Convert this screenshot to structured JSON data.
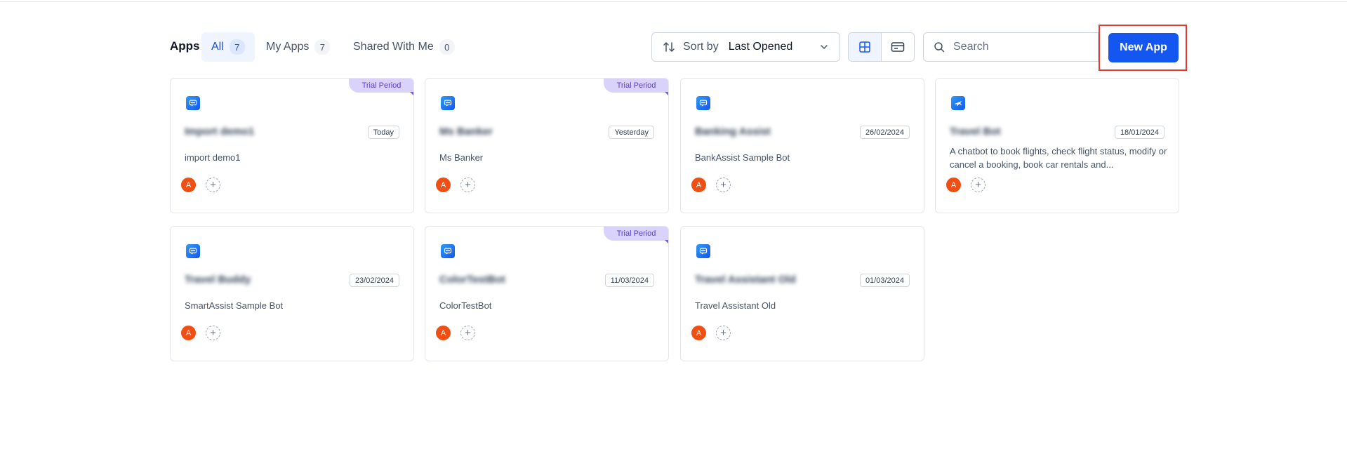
{
  "header": {
    "title": "Apps",
    "tabs": [
      {
        "label": "All",
        "count": "7"
      },
      {
        "label": "My Apps",
        "count": "7"
      },
      {
        "label": "Shared With Me",
        "count": "0"
      }
    ],
    "sort": {
      "label": "Sort by",
      "value": "Last Opened"
    },
    "search": {
      "placeholder": "Search"
    },
    "new_app_label": "New App"
  },
  "colors": {
    "accent": "#1456f0",
    "ribbon": "#d9d2fb",
    "avatar": "#f04f14",
    "highlight": "#e53935"
  },
  "cards": [
    {
      "name": "Import demo1",
      "date": "Today",
      "desc": "import demo1",
      "ribbon": "Trial Period",
      "icon": "chat-bubble-icon",
      "avatar": "A"
    },
    {
      "name": "Ms Banker",
      "date": "Yesterday",
      "desc": "Ms Banker",
      "ribbon": "Trial Period",
      "icon": "chat-bubble-icon",
      "avatar": "A"
    },
    {
      "name": "Banking Assist",
      "date": "26/02/2024",
      "desc": "BankAssist Sample Bot",
      "ribbon": "",
      "icon": "chat-bubble-icon",
      "avatar": "A"
    },
    {
      "name": "Travel Bot",
      "date": "18/01/2024",
      "desc": "A chatbot to book flights, check flight status, modify or cancel a booking, book car rentals and...",
      "ribbon": "",
      "icon": "airplane-icon",
      "avatar": "A"
    },
    {
      "name": "Travel Buddy",
      "date": "23/02/2024",
      "desc": "SmartAssist Sample Bot",
      "ribbon": "",
      "icon": "chat-bubble-icon",
      "avatar": "A"
    },
    {
      "name": "ColorTestBot",
      "date": "11/03/2024",
      "desc": "ColorTestBot",
      "ribbon": "Trial Period",
      "icon": "chat-bubble-icon",
      "avatar": "A"
    },
    {
      "name": "Travel Assistant Old",
      "date": "01/03/2024",
      "desc": "Travel Assistant Old",
      "ribbon": "",
      "icon": "chat-bubble-icon",
      "avatar": "A"
    }
  ]
}
